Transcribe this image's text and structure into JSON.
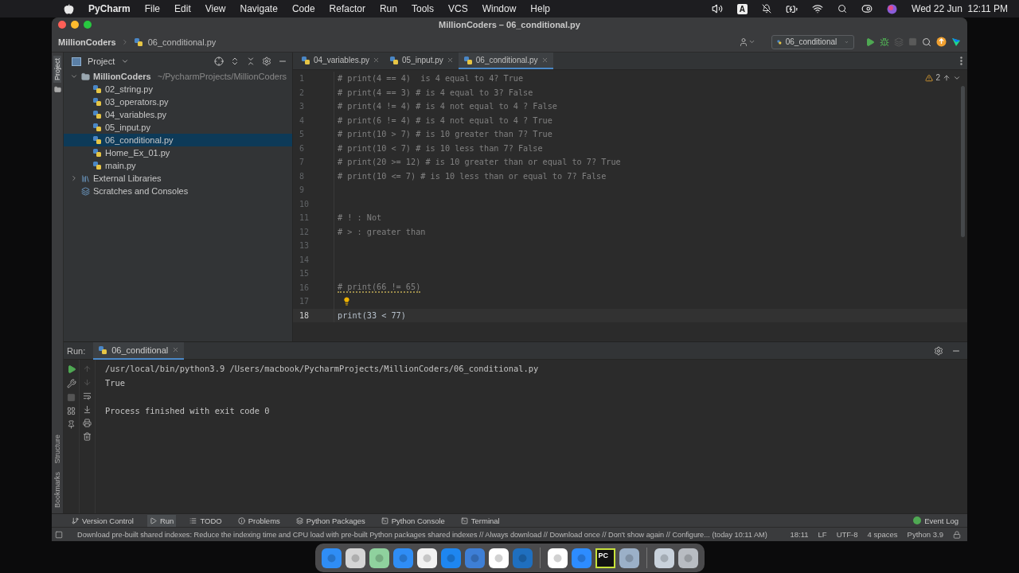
{
  "menubar": {
    "app": "PyCharm",
    "menus": [
      "File",
      "Edit",
      "View",
      "Navigate",
      "Code",
      "Refactor",
      "Run",
      "Tools",
      "VCS",
      "Window",
      "Help"
    ],
    "input_source": "A",
    "clock": "Wed 22 Jun  12:11 PM"
  },
  "window": {
    "title": "MillionCoders – 06_conditional.py"
  },
  "navbar": {
    "breadcrumbs": [
      "MillionCoders",
      "06_conditional.py"
    ],
    "run_config": "06_conditional"
  },
  "side_strip": {
    "top": [
      {
        "label": "Project",
        "selected": true
      }
    ],
    "bottom": [
      {
        "label": "Structure",
        "selected": false
      },
      {
        "label": "Bookmarks",
        "selected": false
      }
    ]
  },
  "project": {
    "title": "Project",
    "tree": [
      {
        "kind": "folder",
        "name": "MillionCoders",
        "path": "~/PycharmProjects/MillionCoders",
        "expanded": true,
        "selected": false,
        "children": [
          {
            "name": "02_string.py",
            "selected": false
          },
          {
            "name": "03_operators.py",
            "selected": false
          },
          {
            "name": "04_variables.py",
            "selected": false
          },
          {
            "name": "05_input.py",
            "selected": false
          },
          {
            "name": "06_conditional.py",
            "selected": true
          },
          {
            "name": "Home_Ex_01.py",
            "selected": false
          },
          {
            "name": "main.py",
            "selected": false
          }
        ]
      },
      {
        "kind": "libraries",
        "name": "External Libraries",
        "expanded": false,
        "selected": false
      },
      {
        "kind": "scratches",
        "name": "Scratches and Consoles",
        "selected": false
      }
    ]
  },
  "editor": {
    "tabs": [
      {
        "label": "04_variables.py",
        "selected": false
      },
      {
        "label": "05_input.py",
        "selected": false
      },
      {
        "label": "06_conditional.py",
        "selected": true
      }
    ],
    "warnings": "2",
    "lines": [
      {
        "number": "1",
        "text": "# print(4 == 4)  is 4 equal to 4? True",
        "kind": "comment",
        "current": false
      },
      {
        "number": "2",
        "text": "# print(4 == 3) # is 4 equal to 3? False",
        "kind": "comment",
        "current": false
      },
      {
        "number": "3",
        "text": "# print(4 != 4) # is 4 not equal to 4 ? False",
        "kind": "comment",
        "current": false
      },
      {
        "number": "4",
        "text": "# print(6 != 4) # is 4 not equal to 4 ? True",
        "kind": "comment",
        "current": false
      },
      {
        "number": "5",
        "text": "# print(10 > 7) # is 10 greater than 7? True",
        "kind": "comment",
        "current": false
      },
      {
        "number": "6",
        "text": "# print(10 < 7) # is 10 less than 7? False",
        "kind": "comment",
        "current": false
      },
      {
        "number": "7",
        "text": "# print(20 >= 12) # is 10 greater than or equal to 7? True",
        "kind": "comment",
        "current": false
      },
      {
        "number": "8",
        "text": "# print(10 <= 7) # is 10 less than or equal to 7? False",
        "kind": "comment",
        "current": false
      },
      {
        "number": "9",
        "kind": "blank",
        "current": false
      },
      {
        "number": "10",
        "kind": "blank",
        "current": false
      },
      {
        "number": "11",
        "text": "# ! : Not",
        "kind": "comment",
        "current": false
      },
      {
        "number": "12",
        "text": "# > : greater than",
        "kind": "comment",
        "current": false
      },
      {
        "number": "13",
        "kind": "blank",
        "current": false
      },
      {
        "number": "14",
        "kind": "blank",
        "current": false
      },
      {
        "number": "15",
        "kind": "blank",
        "current": false
      },
      {
        "number": "16",
        "text": "# print(66 != 65)",
        "kind": "flagged_comment",
        "current": false
      },
      {
        "number": "17",
        "kind": "hint",
        "current": false
      },
      {
        "number": "18",
        "text": "print(33 < 77)",
        "kind": "code",
        "current": true
      }
    ]
  },
  "run": {
    "label": "Run:",
    "tab": "06_conditional",
    "output": [
      {
        "lines": [
          "/usr/local/bin/python3.9 /Users/macbook/PycharmProjects/MillionCoders/06_conditional.py",
          "True"
        ]
      },
      {
        "lines": [
          "Process finished with exit code 0"
        ]
      }
    ]
  },
  "tool_windows": {
    "items": [
      {
        "label": "Version Control",
        "selected": false
      },
      {
        "label": "Run",
        "selected": true
      },
      {
        "label": "TODO",
        "selected": false
      },
      {
        "label": "Problems",
        "selected": false
      },
      {
        "label": "Python Packages",
        "selected": false
      },
      {
        "label": "Python Console",
        "selected": false
      },
      {
        "label": "Terminal",
        "selected": false
      }
    ],
    "event_log": "Event Log"
  },
  "status_bar": {
    "message": "Download pre-built shared indexes: Reduce the indexing time and CPU load with pre-built Python packages shared indexes // Always download // Download once // Don't show again // Configure... (today 10:11 AM)",
    "items": [
      "18:11",
      "LF",
      "UTF-8",
      "4 spaces",
      "Python 3.9"
    ]
  },
  "dock": {
    "ide_logo": "PC"
  }
}
